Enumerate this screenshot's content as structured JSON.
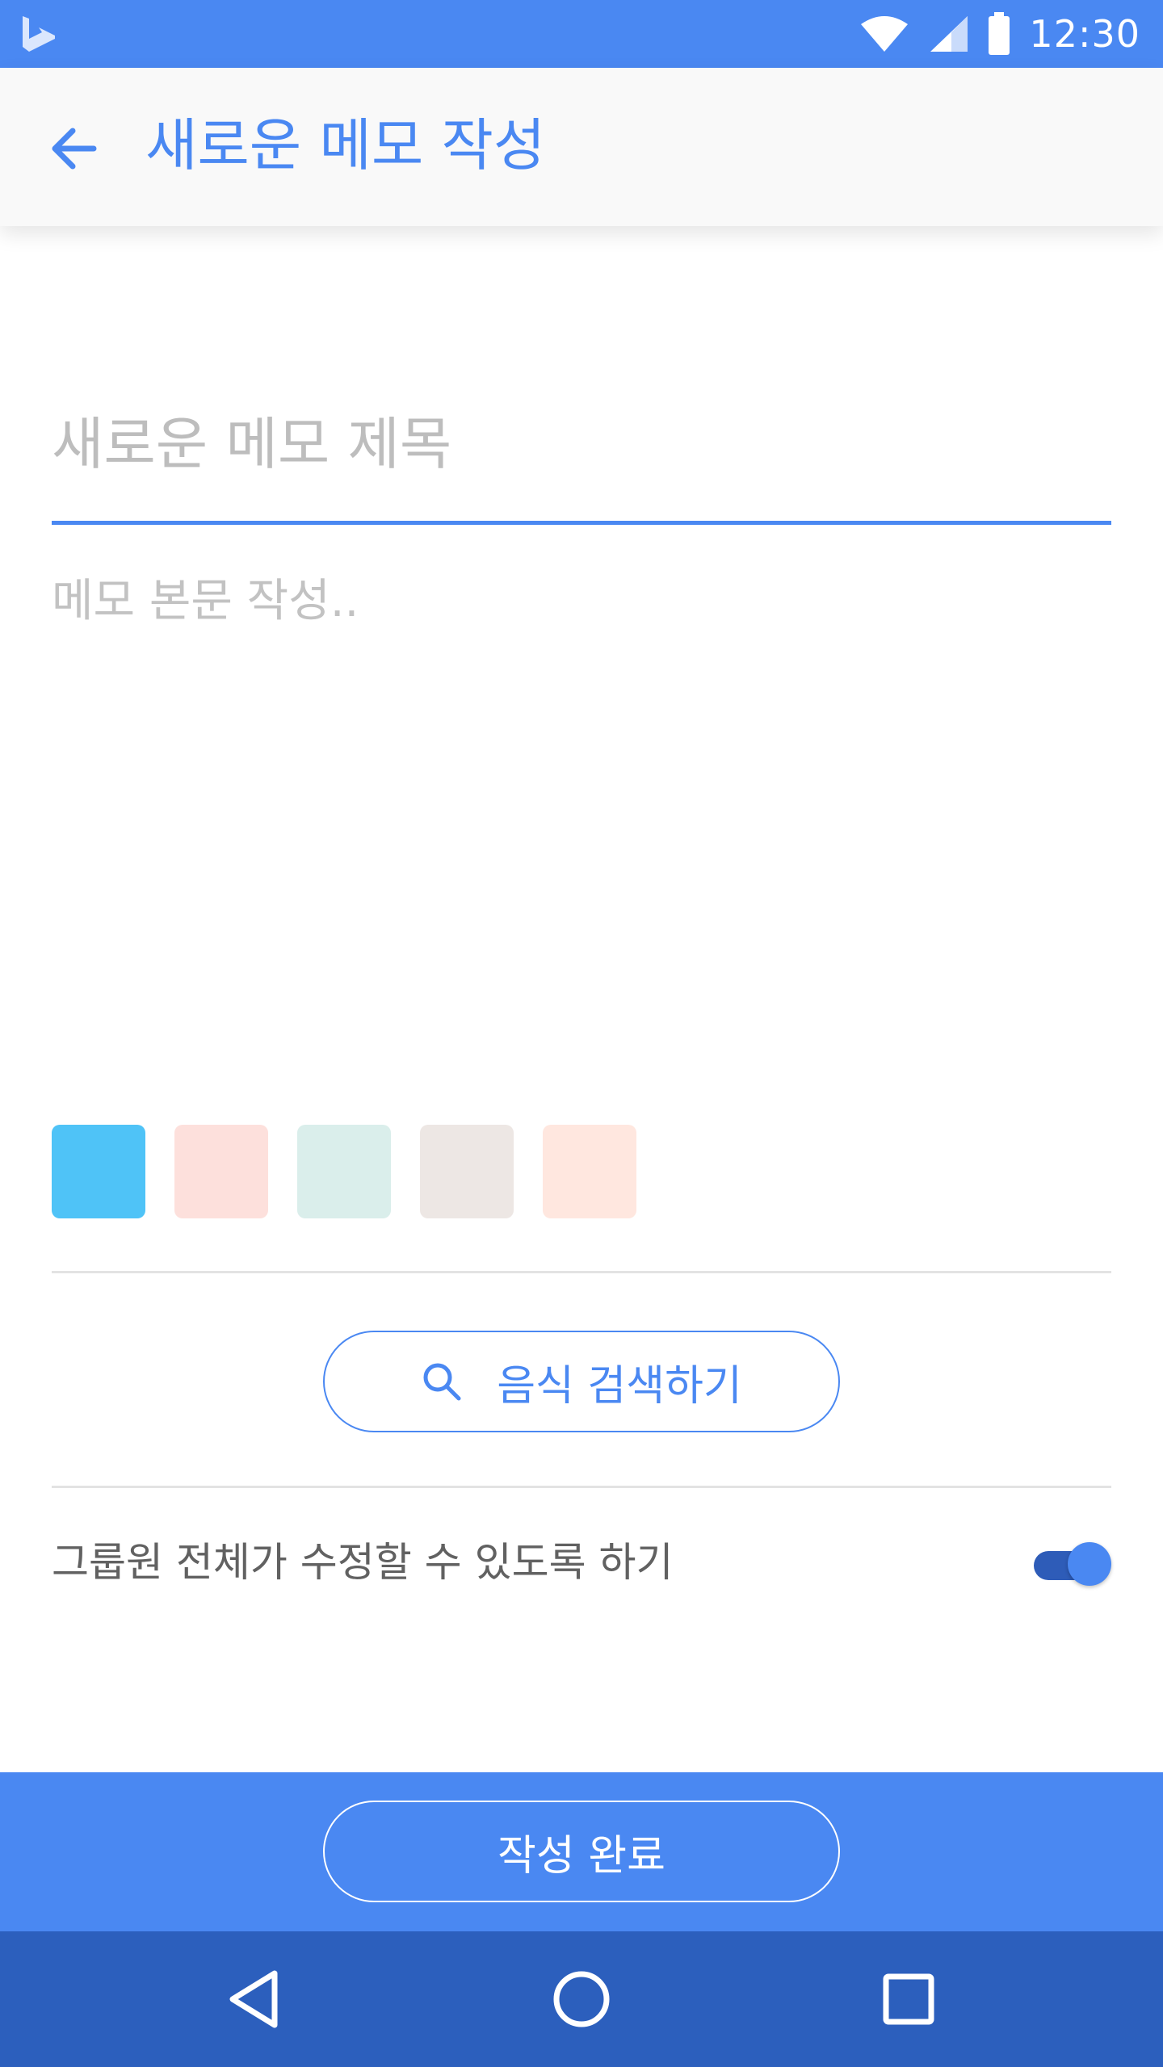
{
  "status_bar": {
    "time": "12:30",
    "icons": [
      "bing-logo-icon",
      "wifi-icon",
      "signal-icon",
      "battery-icon"
    ]
  },
  "app_bar": {
    "back_icon": "arrow-left-icon",
    "title": "새로운 메모 작성"
  },
  "form": {
    "title_placeholder": "새로운 메모 제목",
    "title_value": "",
    "body_placeholder": "메모 본문 작성..",
    "body_value": ""
  },
  "color_swatches": [
    {
      "color": "#4fc3f7",
      "selected": true
    },
    {
      "color": "#fde0dc",
      "selected": false
    },
    {
      "color": "#daeeeb",
      "selected": false
    },
    {
      "color": "#ede7e4",
      "selected": false
    },
    {
      "color": "#ffe7df",
      "selected": false
    }
  ],
  "search_button": {
    "icon": "search-icon",
    "label": "음식 검색하기"
  },
  "group_edit": {
    "label": "그룹원 전체가 수정할 수 있도록 하기",
    "enabled": true
  },
  "complete_button": {
    "label": "작성 완료"
  },
  "nav": {
    "back_icon": "nav-back-triangle-icon",
    "home_icon": "nav-home-circle-icon",
    "recents_icon": "nav-recents-square-icon"
  },
  "colors": {
    "primary": "#4a88f2",
    "nav_bar": "#2c5fbd",
    "toggle_track": "#2e5cb8"
  }
}
